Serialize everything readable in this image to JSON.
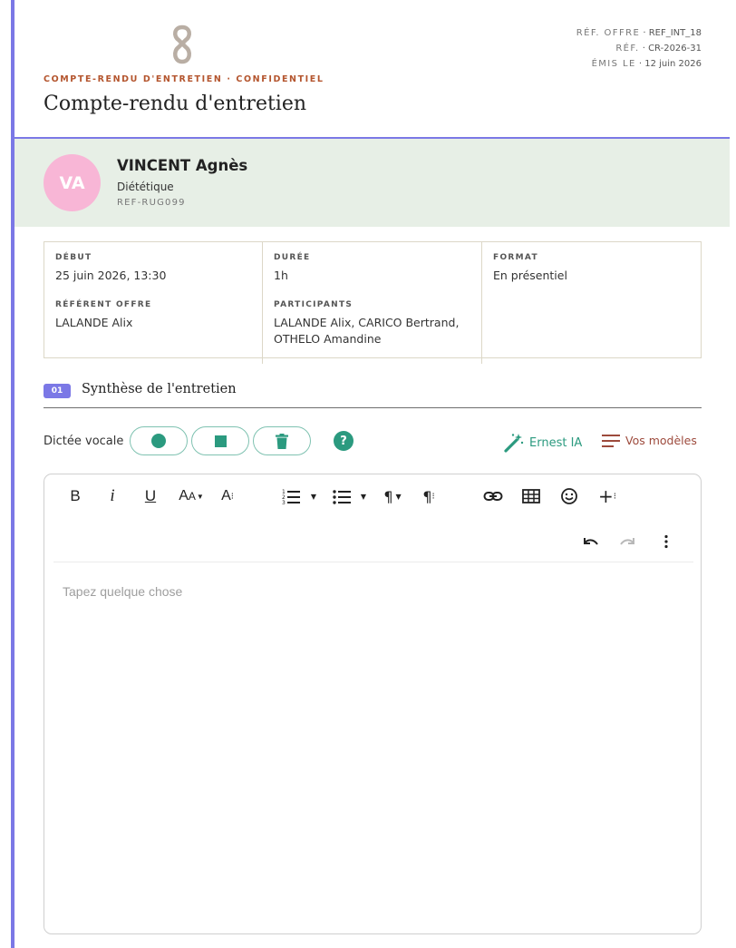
{
  "header": {
    "kicker": "COMPTE-RENDU D'ENTRETIEN · CONFIDENTIEL",
    "title": "Compte-rendu d'entretien",
    "refs": [
      {
        "label": "RÉF. OFFRE",
        "value": "REF_INT_18"
      },
      {
        "label": "RÉF.",
        "value": "CR-2026-31"
      },
      {
        "label": "ÉMIS LE",
        "value": "12 juin 2026"
      }
    ]
  },
  "candidate": {
    "initials": "VA",
    "name": "VINCENT Agnès",
    "field": "Diététique",
    "ref": "REF-RUG099"
  },
  "info": {
    "start_label": "DÉBUT",
    "start_value": "25 juin 2026, 13:30",
    "duration_label": "DURÉE",
    "duration_value": "1h",
    "format_label": "FORMAT",
    "format_value": "En présentiel",
    "referent_label": "RÉFÉRENT OFFRE",
    "referent_value": "LALANDE Alix",
    "participants_label": "PARTICIPANTS",
    "participants_value": "LALANDE Alix, CARICO Bertrand, OTHELO Amandine"
  },
  "section": {
    "number": "01",
    "title": "Synthèse de l'entretien"
  },
  "dictation": {
    "label": "Dictée vocale",
    "help": "?",
    "ernest_label": "Ernest IA",
    "models_label": "Vos modèles"
  },
  "editor": {
    "placeholder": "Tapez quelque chose"
  },
  "colors": {
    "accent": "#7b78e6",
    "green": "#2b9a7f",
    "kicker": "#b4552e",
    "avatar": "#f8b6d6",
    "band": "#e7efe6",
    "models": "#9d4a3c"
  }
}
